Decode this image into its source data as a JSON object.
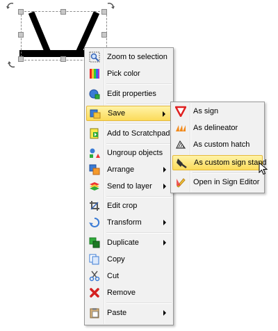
{
  "context_menu": {
    "items": [
      {
        "label": "Zoom to selection",
        "icon": "zoom-selection-icon"
      },
      {
        "label": "Pick color",
        "icon": "pick-color-icon"
      },
      {
        "label": "Edit properties",
        "icon": "edit-properties-icon"
      },
      {
        "label": "Save",
        "icon": "save-icon",
        "submenu": true,
        "highlighted": true
      },
      {
        "label": "Add to Scratchpad",
        "icon": "scratchpad-icon"
      },
      {
        "label": "Ungroup objects",
        "icon": "ungroup-icon"
      },
      {
        "label": "Arrange",
        "icon": "arrange-icon",
        "submenu": true
      },
      {
        "label": "Send to layer",
        "icon": "layer-icon",
        "submenu": true
      },
      {
        "label": "Edit crop",
        "icon": "crop-icon"
      },
      {
        "label": "Transform",
        "icon": "transform-icon",
        "submenu": true
      },
      {
        "label": "Duplicate",
        "icon": "duplicate-icon",
        "submenu": true
      },
      {
        "label": "Copy",
        "icon": "copy-icon"
      },
      {
        "label": "Cut",
        "icon": "cut-icon"
      },
      {
        "label": "Remove",
        "icon": "remove-icon"
      },
      {
        "label": "Paste",
        "icon": "paste-icon",
        "submenu": true
      }
    ]
  },
  "save_submenu": {
    "items": [
      {
        "label": "As sign",
        "icon": "sign-icon"
      },
      {
        "label": "As delineator",
        "icon": "delineator-icon"
      },
      {
        "label": "As custom hatch",
        "icon": "hatch-icon"
      },
      {
        "label": "As custom sign stand",
        "icon": "sign-stand-icon",
        "highlighted": true
      },
      {
        "label": "Open in Sign Editor",
        "icon": "sign-editor-icon"
      }
    ]
  },
  "colors": {
    "highlight_top": "#fff3a8",
    "highlight_bottom": "#fbdb5a",
    "menu_background": "#f1f1f1"
  }
}
